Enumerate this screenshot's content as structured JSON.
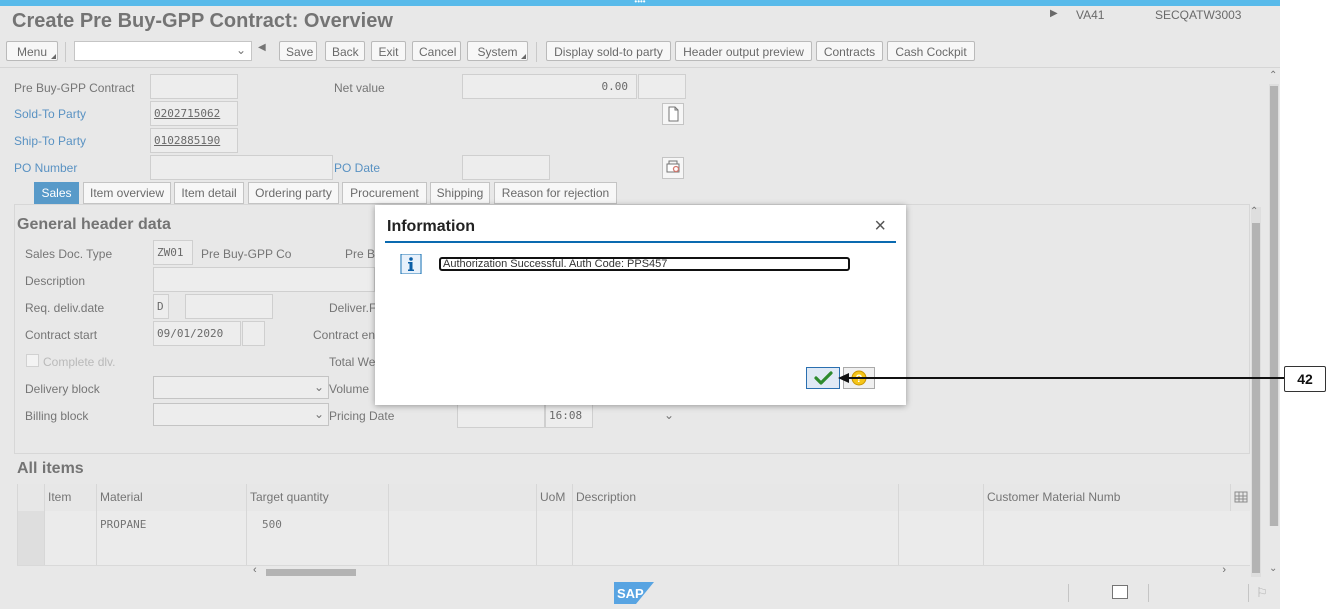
{
  "window": {
    "title": "Create Pre Buy-GPP Contract: Overview"
  },
  "toolbar": {
    "menu": "Menu",
    "save": "Save",
    "back": "Back",
    "exit": "Exit",
    "cancel": "Cancel",
    "system": "System",
    "display_sold_to": "Display sold-to party",
    "header_output_preview": "Header output preview",
    "contracts": "Contracts",
    "cash_cockpit": "Cash Cockpit"
  },
  "header": {
    "contract_label": "Pre Buy-GPP Contract",
    "contract_value": "",
    "net_value_label": "Net value",
    "net_value": "0.00",
    "sold_to_label": "Sold-To Party",
    "sold_to_value": "0202715062",
    "ship_to_label": "Ship-To Party",
    "ship_to_value": "0102885190",
    "po_number_label": "PO Number",
    "po_date_label": "PO Date"
  },
  "tabs": [
    {
      "label": "Sales"
    },
    {
      "label": "Item overview"
    },
    {
      "label": "Item detail"
    },
    {
      "label": "Ordering party"
    },
    {
      "label": "Procurement"
    },
    {
      "label": "Shipping"
    },
    {
      "label": "Reason for rejection"
    }
  ],
  "general": {
    "title": "General header data",
    "sales_doc_type_label": "Sales Doc. Type",
    "sales_doc_type_code": "ZW01",
    "sales_doc_type_text": "Pre Buy-GPP Co",
    "pre_label_partial": "Pre B",
    "description_label": "Description",
    "req_deliv_label": "Req. deliv.date",
    "req_deliv_code": "D",
    "deliver_partial": "Deliver.F",
    "contract_start_label": "Contract start",
    "contract_start_value": "09/01/2020",
    "contract_end_partial": "Contract en",
    "complete_dlv_label": "Complete dlv.",
    "total_we_partial": "Total We",
    "delivery_block_label": "Delivery block",
    "volume_label": "Volume",
    "billing_block_label": "Billing block",
    "pricing_date_label": "Pricing Date",
    "time_value": "16:08"
  },
  "items": {
    "title": "All items",
    "columns": [
      "Item",
      "Material",
      "Target quantity",
      "UoM",
      "Description",
      "Customer Material Numb"
    ],
    "rows": [
      {
        "item": "",
        "material": "PROPANE",
        "qty": "500",
        "uom": "",
        "description": "",
        "cust_mat": ""
      },
      {
        "item": "",
        "material": "",
        "qty": "",
        "uom": "",
        "description": "",
        "cust_mat": ""
      }
    ]
  },
  "statusbar": {
    "tcode": "VA41",
    "system": "SECQATW3003",
    "logo": "SAP"
  },
  "dialog": {
    "title": "Information",
    "message": "Authorization Successful. Auth Code: PPS457"
  },
  "annotation": {
    "label": "42"
  },
  "colors": {
    "accent": "#0a6ab0",
    "topbar": "#0a9ae0",
    "link": "#0a5ea6"
  }
}
